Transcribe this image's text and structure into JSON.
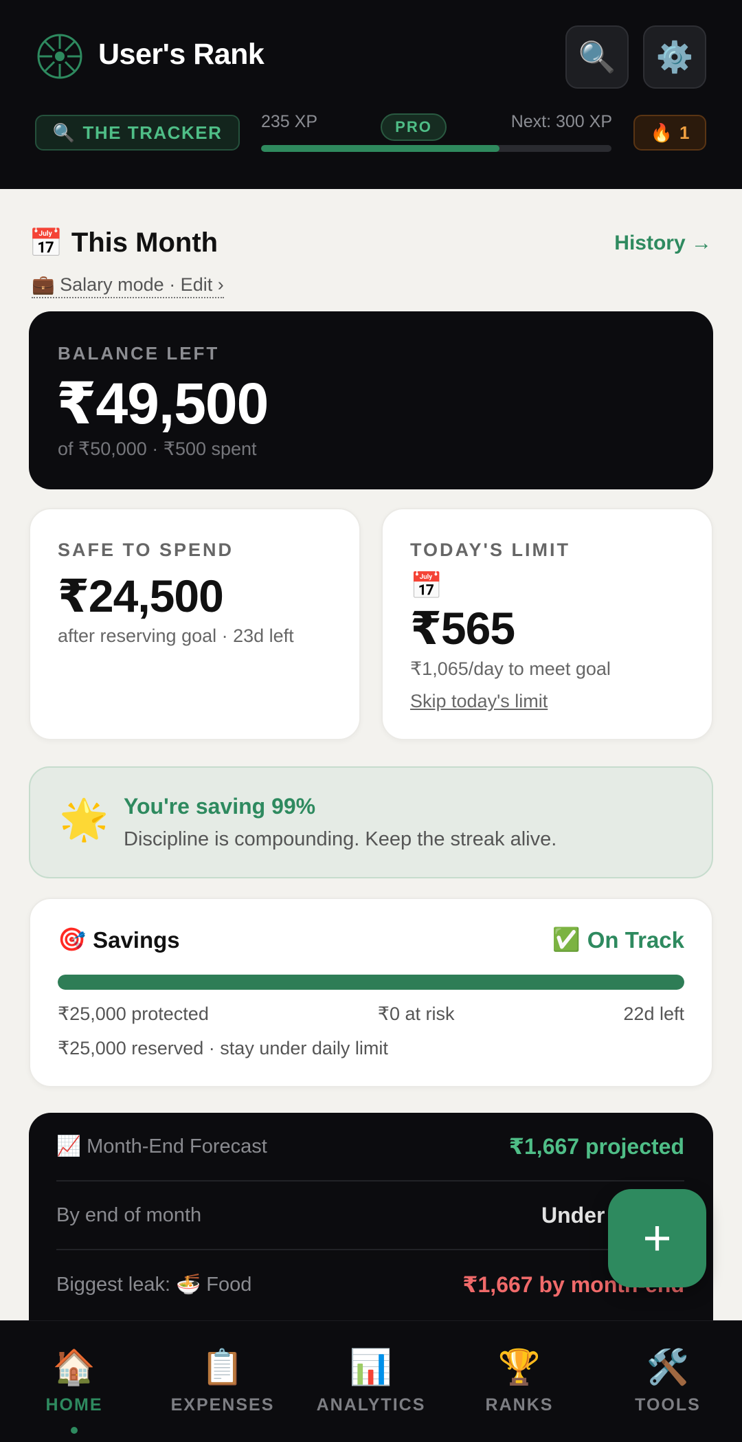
{
  "header": {
    "app_title": "User's Rank",
    "tracker_label": "THE TRACKER",
    "xp_current": "235 XP",
    "badge": "PRO",
    "xp_next": "Next: 300 XP",
    "xp_progress": 0.68,
    "streak_count": "1"
  },
  "month": {
    "title": "This Month",
    "history_link": "History →",
    "salary_mode": "💼 Salary mode · Edit ›"
  },
  "balance": {
    "label": "BALANCE LEFT",
    "value": "₹49,500",
    "sub": "of ₹50,000 · ₹500 spent"
  },
  "safe_to_spend": {
    "label": "SAFE TO SPEND",
    "value": "₹24,500",
    "sub": "after reserving goal · 23d left"
  },
  "todays_limit": {
    "label": "TODAY'S LIMIT",
    "value": "₹565",
    "sub": "₹1,065/day to meet goal",
    "skip": "Skip today's limit"
  },
  "tip": {
    "title": "You're saving 99%",
    "text": "Discipline is compounding. Keep the streak alive."
  },
  "savings": {
    "title": "Savings",
    "status": "On Track",
    "progress": 1.0,
    "protected": "₹25,000 protected",
    "at_risk": "₹0 at risk",
    "days_left": "22d left",
    "note": "₹25,000 reserved · stay under daily limit"
  },
  "forecast": {
    "rows": [
      {
        "label": "Month-End Forecast",
        "value": "₹1,667 projected",
        "color": "#4fbe87"
      },
      {
        "label": "By end of month",
        "value": "Under budget",
        "color": "#e2e2e2"
      },
      {
        "label": "Biggest leak: 🍜 Food",
        "value": "₹1,667 by month-end",
        "color": "#f06a6a"
      }
    ]
  },
  "fab_label": "+",
  "nav": {
    "items": [
      {
        "label": "HOME",
        "icon": "house-icon"
      },
      {
        "label": "EXPENSES",
        "icon": "clipboard-icon"
      },
      {
        "label": "ANALYTICS",
        "icon": "bar-chart-icon"
      },
      {
        "label": "RANKS",
        "icon": "trophy-icon"
      },
      {
        "label": "TOOLS",
        "icon": "tools-icon"
      }
    ]
  },
  "colors": {
    "accent": "#2e8a5f",
    "dark_bg": "#0c0c0f",
    "page_bg": "#f3f2ee"
  }
}
